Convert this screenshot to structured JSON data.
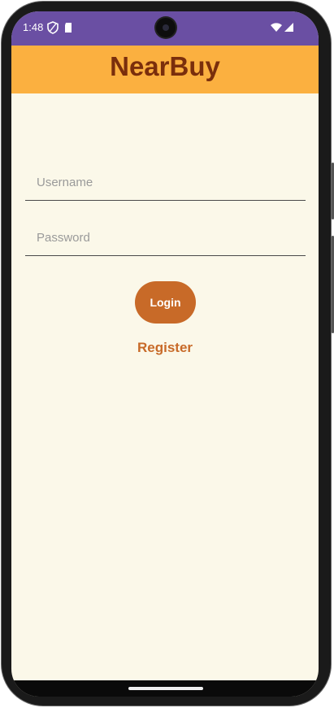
{
  "status_bar": {
    "time": "1:48",
    "icons": [
      "shield-icon",
      "sd-card-icon",
      "wifi-icon",
      "signal-icon"
    ],
    "color": "#6a4fa3"
  },
  "app_bar": {
    "title": "NearBuy",
    "background": "#fbb040",
    "title_color": "#7a2e0c"
  },
  "login_form": {
    "username_placeholder": "Username",
    "password_placeholder": "Password",
    "login_label": "Login",
    "register_label": "Register",
    "accent": "#c86a28"
  },
  "background": "#fbf8e9"
}
